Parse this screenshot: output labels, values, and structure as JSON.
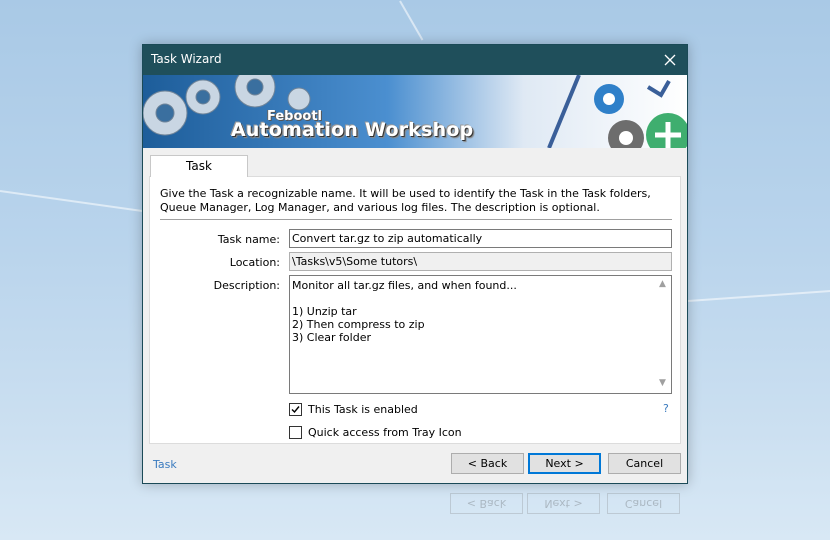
{
  "window": {
    "title": "Task Wizard"
  },
  "banner": {
    "brand_small": "Febootl",
    "brand_big": "Automation Workshop"
  },
  "tab": {
    "label": "Task"
  },
  "intro_text": "Give the Task a recognizable name. It will be used to identify the Task in the Task folders, Queue Manager, Log Manager, and various log files. The description is optional.",
  "form": {
    "task_name_label": "Task name:",
    "task_name_value": "Convert tar.gz to zip automatically",
    "location_label": "Location:",
    "location_value": "\\Tasks\\v5\\Some tutors\\",
    "description_label": "Description:",
    "description_value": "Monitor all tar.gz files, and when found...\n\n1) Unzip tar\n2) Then compress to zip\n3) Clear folder",
    "enabled_label": "This Task is enabled",
    "enabled_checked": true,
    "tray_label": "Quick access from Tray Icon",
    "tray_checked": false,
    "help_glyph": "?"
  },
  "footer": {
    "section_label": "Task",
    "back_label": "< Back",
    "next_label": "Next >",
    "cancel_label": "Cancel"
  },
  "colors": {
    "titlebar": "#1f4f5b",
    "accent": "#0078d7",
    "link": "#3b7bbf"
  }
}
